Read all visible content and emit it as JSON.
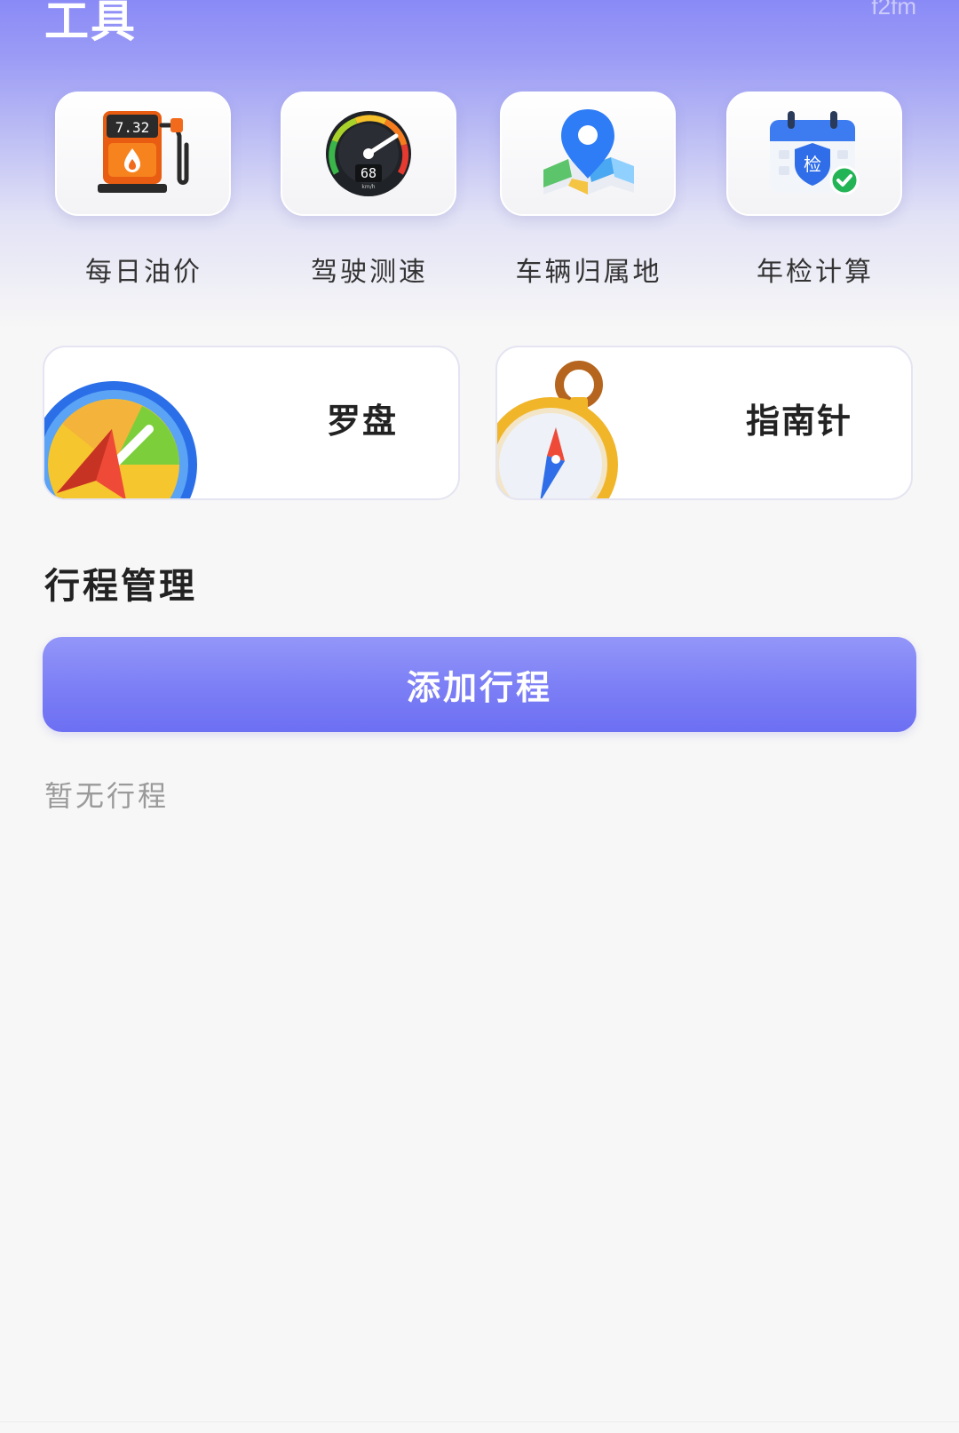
{
  "header": {
    "title": "工具",
    "watermark": "f2fm"
  },
  "tools": [
    {
      "label": "每日油价",
      "icon": "fuel-pump-icon",
      "display_price": "7.32"
    },
    {
      "label": "驾驶测速",
      "icon": "speedometer-icon",
      "speed": "68",
      "unit": "km/h"
    },
    {
      "label": "车辆归属地",
      "icon": "map-pin-icon"
    },
    {
      "label": "年检计算",
      "icon": "calendar-check-icon",
      "badge": "检"
    }
  ],
  "cards": [
    {
      "label": "罗盘",
      "icon": "compass-dial-icon"
    },
    {
      "label": "指南针",
      "icon": "pocket-compass-icon"
    }
  ],
  "trips": {
    "section_title": "行程管理",
    "add_label": "添加行程",
    "empty_text": "暂无行程"
  },
  "colors": {
    "accent": "#7b7ef5",
    "header_top": "#8a8af7",
    "background": "#f7f7f7",
    "fuel_orange": "#f26a1b",
    "gauge_dark": "#2a2d33",
    "pin_blue": "#2f7df6",
    "check_green": "#22b455"
  }
}
